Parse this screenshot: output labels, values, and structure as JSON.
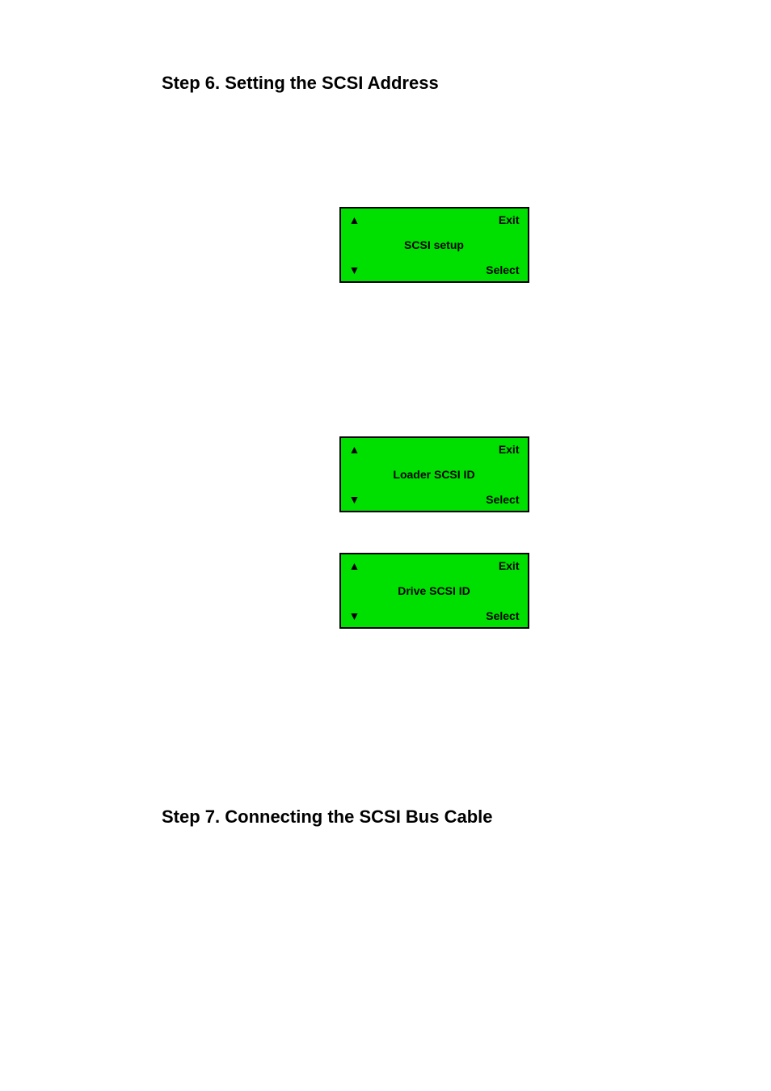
{
  "headings": {
    "step6": "Step 6. Setting the SCSI Address",
    "step7": "Step 7. Connecting the SCSI Bus Cable"
  },
  "lcds": [
    {
      "center": "SCSI setup",
      "tl": "▲",
      "tr": "Exit",
      "bl": "▼",
      "br": "Select"
    },
    {
      "center": "Loader SCSI ID",
      "tl": "▲",
      "tr": "Exit",
      "bl": "▼",
      "br": "Select"
    },
    {
      "center": "Drive SCSI ID",
      "tl": "▲",
      "tr": "Exit",
      "bl": "▼",
      "br": "Select"
    }
  ]
}
